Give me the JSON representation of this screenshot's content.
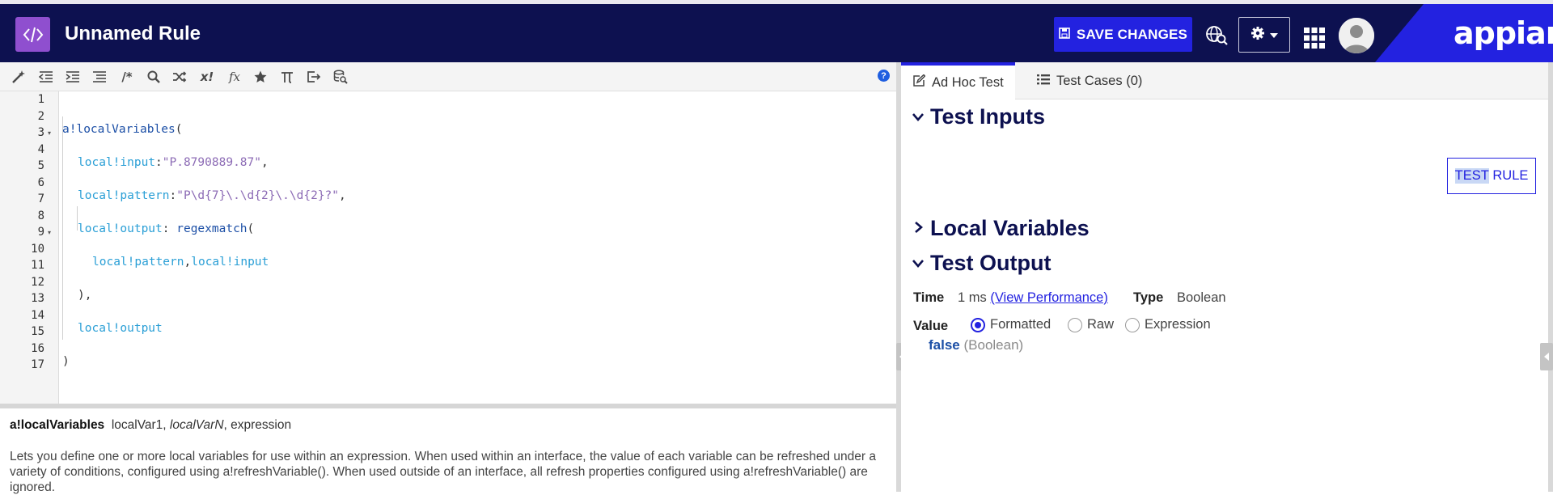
{
  "header": {
    "rule_icon": "code-brackets-icon",
    "title": "Unnamed Rule",
    "save_label": "SAVE CHANGES",
    "logo_text": "appian",
    "colors": {
      "bar": "#0d1150",
      "accent": "#2322e0",
      "rule_icon_bg": "#8f4fcf"
    }
  },
  "toolbar": {
    "icons": [
      "magic-wand-icon",
      "outdent-icon",
      "indent-icon",
      "list-icon",
      "comment-icon",
      "search-icon",
      "shuffle-icon",
      "clear-expression-icon",
      "function-icon",
      "favorite-star-icon",
      "pi-constant-icon",
      "export-icon",
      "database-search-icon"
    ],
    "comment_glyph": "/*",
    "clear_glyph": "x!",
    "function_glyph": "fx",
    "help_glyph": "?"
  },
  "code": {
    "line_numbers": [
      "1",
      "2",
      "3",
      "4",
      "5",
      "6",
      "7",
      "8",
      "9",
      "10",
      "11",
      "12",
      "13",
      "14",
      "15",
      "16",
      "17"
    ],
    "fold_lines": [
      3,
      9
    ],
    "lines": {
      "l3_fn": "a!localVariables",
      "l3_p": "(",
      "l5_var": "local!input",
      "l5_colon": ":",
      "l5_str": "\"P.8790889.87\"",
      "l5_comma": ",",
      "l7_var": "local!pattern",
      "l7_colon": ":",
      "l7_str": "\"P\\d{7}\\.\\d{2}\\.\\d{2}?\"",
      "l7_comma": ",",
      "l9_var": "local!output",
      "l9_colon": ": ",
      "l9_fn": "regexmatch",
      "l9_p": "(",
      "l11_var1": "local!pattern",
      "l11_comma": ",",
      "l11_var2": "local!input",
      "l13": "),",
      "l15_var": "local!output",
      "l17": ")"
    }
  },
  "doc": {
    "fn_name": "a!localVariables",
    "param1": "localVar1,",
    "param2": "localVarN",
    "param3": ", expression",
    "description": "Lets you define one or more local variables for use within an expression. When used within an interface, the value of each variable can be refreshed under a variety of conditions, configured using a!refreshVariable(). When used outside of an interface, all refresh properties configured using a!refreshVariable() are ignored."
  },
  "tabs": [
    {
      "label": "Ad Hoc Test",
      "icon": "edit-icon",
      "active": true
    },
    {
      "label": "Test Cases (0)",
      "icon": "list-icon",
      "active": false
    }
  ],
  "sections": {
    "test_inputs": "Test Inputs",
    "local_variables": "Local Variables",
    "test_output": "Test Output"
  },
  "test_rule": {
    "part1": "TEST",
    "part2": " RULE"
  },
  "output": {
    "time_label": "Time",
    "time_value": "1 ms",
    "view_perf": "(View Performance)",
    "type_label": "Type",
    "type_value": "Boolean",
    "value_label": "Value",
    "radios": [
      {
        "label": "Formatted",
        "selected": true
      },
      {
        "label": "Raw",
        "selected": false
      },
      {
        "label": "Expression",
        "selected": false
      }
    ],
    "result": "false",
    "result_type": "(Boolean)"
  }
}
